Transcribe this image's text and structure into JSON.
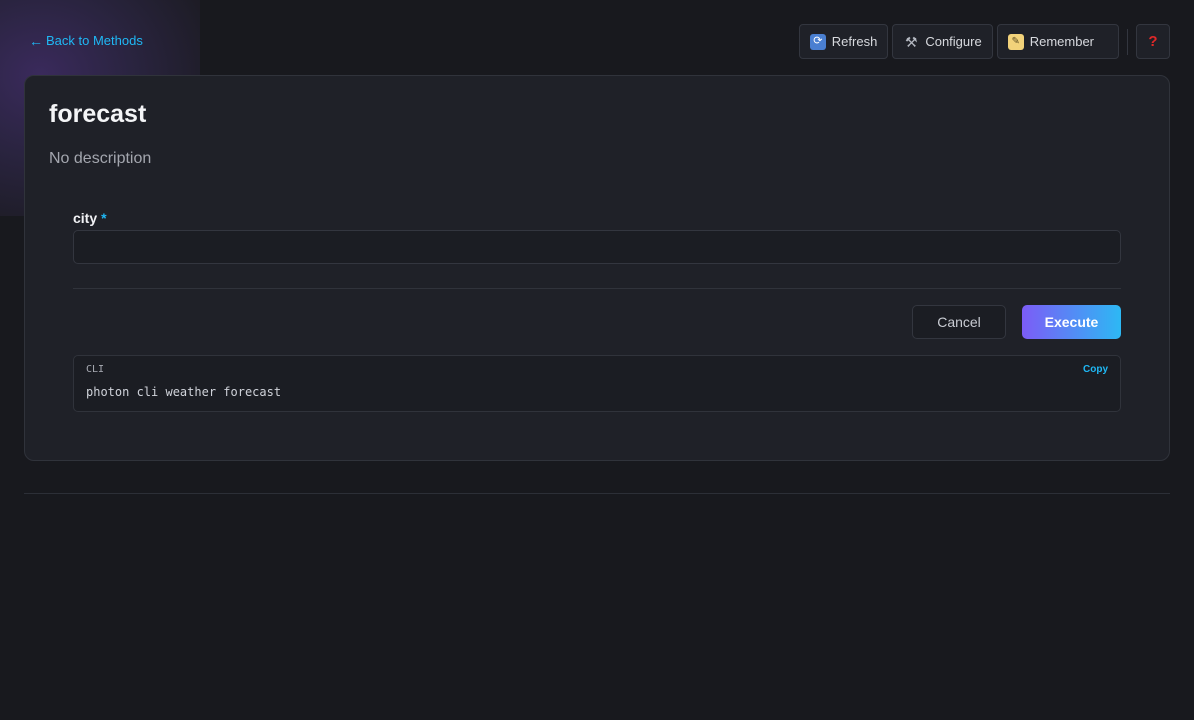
{
  "nav": {
    "back_label": "Back to Methods",
    "back_arrow": "←"
  },
  "toolbar": {
    "refresh_label": "Refresh",
    "refresh_icon": "🔄",
    "configure_label": "Configure",
    "configure_icon": "🔧",
    "remember_label": "Remember",
    "remember_icon": "📝",
    "help_icon": "❓"
  },
  "method": {
    "title": "forecast",
    "description": "No description"
  },
  "form": {
    "city_label": "city",
    "required_marker": "*",
    "city_value": ""
  },
  "actions": {
    "cancel_label": "Cancel",
    "execute_label": "Execute"
  },
  "cli": {
    "label": "CLI",
    "copy_label": "Copy",
    "command": "photon cli weather forecast"
  },
  "colors": {
    "accent": "#1fb8f5",
    "execute_gradient_start": "#7c5cf6",
    "execute_gradient_end": "#2db8f4",
    "background": "#18191e",
    "card": "#1f2128"
  }
}
